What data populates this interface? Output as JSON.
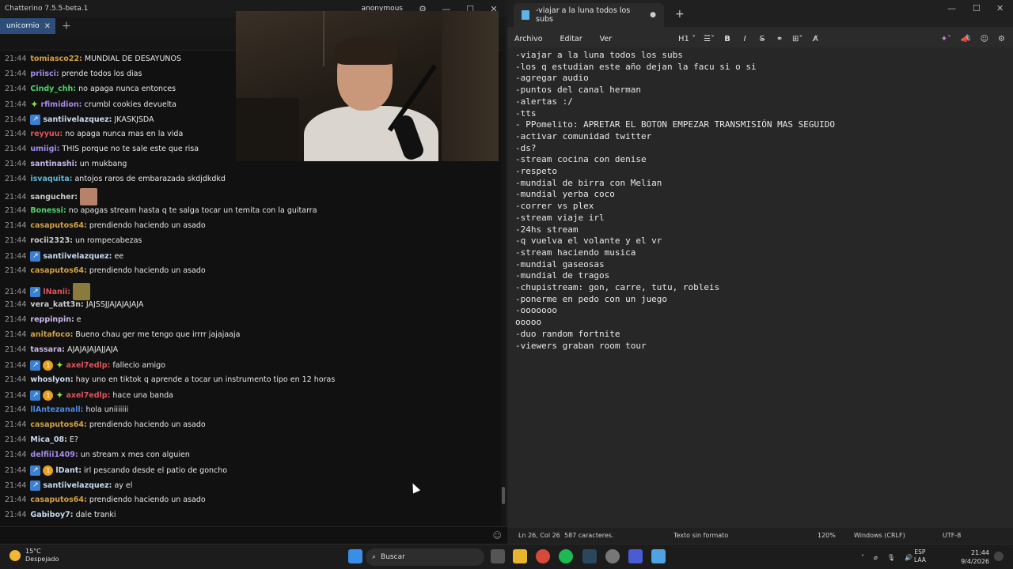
{
  "chatterino": {
    "window_title": "Chatterino 7.5.5-beta.1",
    "account": "anonymous",
    "tab_label": "unicornio",
    "channel_header": "unicornio",
    "messages": [
      {
        "ts": "21:44",
        "user": "tomiasco22:",
        "color": "#d3a042",
        "text": "MUNDIAL DE DESAYUNOS"
      },
      {
        "ts": "21:44",
        "user": "priisci:",
        "color": "#a48ae8",
        "text": "prende todos los dias"
      },
      {
        "ts": "21:44",
        "user": "Cindy_chh:",
        "color": "#4fd36d",
        "text": "no apaga nunca entonces"
      },
      {
        "ts": "21:44",
        "user": "rfimidion:",
        "color": "#a48ae8",
        "text": "crumbl cookies devuelta",
        "badges": [
          "star"
        ]
      },
      {
        "ts": "21:44",
        "user": "santiivelazquez:",
        "color": "#c9d9f0",
        "text": "JKASKJSDA",
        "badges": [
          "blue"
        ]
      },
      {
        "ts": "21:44",
        "user": "reyyuu:",
        "color": "#e0545c",
        "text": "no apaga nunca mas en la vida"
      },
      {
        "ts": "21:44",
        "user": "umiigi:",
        "color": "#a48ae8",
        "text": "THIS porque no te sale este que risa"
      },
      {
        "ts": "21:44",
        "user": "santinashi:",
        "color": "#c9b6e8",
        "text": "un mukbang"
      },
      {
        "ts": "21:44",
        "user": "isvaquita:",
        "color": "#5fb7d6",
        "text": "antojos raros de embarazada skdjdkdkd"
      },
      {
        "ts": "21:44",
        "user": "sangucher:",
        "color": "#c9c9c9",
        "text": "",
        "emote": "#b8826a"
      },
      {
        "ts": "21:44",
        "user": "Bonessi:",
        "color": "#4fd36d",
        "text": "no apagas stream hasta q te salga tocar un temita con la guitarra"
      },
      {
        "ts": "21:44",
        "user": "casaputos64:",
        "color": "#d3a042",
        "text": "prendiendo haciendo un asado"
      },
      {
        "ts": "21:44",
        "user": "rocii2323:",
        "color": "#c9c9c9",
        "text": "un rompecabezas"
      },
      {
        "ts": "21:44",
        "user": "santiivelazquez:",
        "color": "#c9d9f0",
        "text": "ee",
        "badges": [
          "blue"
        ]
      },
      {
        "ts": "21:44",
        "user": "casaputos64:",
        "color": "#d3a042",
        "text": "prendiendo haciendo un asado"
      },
      {
        "ts": "21:44",
        "user": "lNanii:",
        "color": "#e0545c",
        "text": "",
        "badges": [
          "blue"
        ],
        "emote": "#8a7a3c"
      },
      {
        "ts": "21:44",
        "user": "vera_katt3n:",
        "color": "#c9c9c9",
        "text": "JAJSSJJAJAJAJAJA"
      },
      {
        "ts": "21:44",
        "user": "reppinpin:",
        "color": "#c9b6e8",
        "text": "e"
      },
      {
        "ts": "21:44",
        "user": "anitafoco:",
        "color": "#d3a042",
        "text": "Bueno chau ger me tengo que irrrr jajajaaja"
      },
      {
        "ts": "21:44",
        "user": "tassara:",
        "color": "#c9b6e8",
        "text": "AJAJAJAJAJJAJA"
      },
      {
        "ts": "21:44",
        "user": "axel7edlp:",
        "color": "#e0545c",
        "text": "fallecio amigo",
        "badges": [
          "blue",
          "gold",
          "star"
        ]
      },
      {
        "ts": "21:44",
        "user": "whoslyon:",
        "color": "#c9d9f0",
        "text": "hay uno en tiktok q aprende a tocar un instrumento tipo en 12 horas"
      },
      {
        "ts": "21:44",
        "user": "axel7edlp:",
        "color": "#e0545c",
        "text": "hace una banda",
        "badges": [
          "blue",
          "gold",
          "star"
        ]
      },
      {
        "ts": "21:44",
        "user": "llAntezanall:",
        "color": "#4f8ae0",
        "text": "hola uniiiiiii"
      },
      {
        "ts": "21:44",
        "user": "casaputos64:",
        "color": "#d3a042",
        "text": "prendiendo haciendo un asado"
      },
      {
        "ts": "21:44",
        "user": "Mica_08:",
        "color": "#c9d9f0",
        "text": "E?"
      },
      {
        "ts": "21:44",
        "user": "delfiii1409:",
        "color": "#a48ae8",
        "text": "un stream x mes con alguien"
      },
      {
        "ts": "21:44",
        "user": "lDant:",
        "color": "#c9d9f0",
        "text": "irl pescando desde el patio de goncho",
        "badges": [
          "blue",
          "gold"
        ]
      },
      {
        "ts": "21:44",
        "user": "santiivelazquez:",
        "color": "#c9d9f0",
        "text": "ay el",
        "badges": [
          "blue"
        ]
      },
      {
        "ts": "21:44",
        "user": "casaputos64:",
        "color": "#d3a042",
        "text": "prendiendo haciendo un asado"
      },
      {
        "ts": "21:44",
        "user": "Gabiboy7:",
        "color": "#c9d9f0",
        "text": "dale tranki"
      }
    ]
  },
  "notepad": {
    "tab_title": "-viajar a la luna todos los subs",
    "menu": [
      "Archivo",
      "Editar",
      "Ver"
    ],
    "heading_select": "H1",
    "content": "-viajar a la luna todos los subs\n-los q estudian este año dejan la facu si o si\n-agregar audio\n-puntos del canal herman\n-alertas :/\n-tts\n- PPomelito: APRETAR EL BOTON EMPEZAR TRANSMISIÓN MAS SEGUIDO\n-activar comunidad twitter\n-ds?\n-stream cocina con denise\n-respeto\n-mundial de birra con Melian\n-mundial yerba coco\n-correr vs plex\n-stream viaje irl\n-24hs stream\n-q vuelva el volante y el vr\n-stream haciendo musica\n-mundial gaseosas\n-mundial de tragos\n-chupistream: gon, carre, tutu, robleis\n-ponerme en pedo con un juego\n-ooooooo\nooooo\n-duo random fortnite\n-viewers graban room tour",
    "status": {
      "position": "Ln 26, Col 26",
      "chars": "587 caracteres.",
      "format": "Texto sin formato",
      "zoom": "120%",
      "eol": "Windows (CRLF)",
      "encoding": "UTF-8"
    }
  },
  "taskbar": {
    "weather_temp": "15°C",
    "weather_desc": "Despejado",
    "search_placeholder": "Buscar",
    "lang_top": "ESP",
    "lang_bottom": "LAA",
    "time": "21:44",
    "date": "9/4/2026"
  }
}
